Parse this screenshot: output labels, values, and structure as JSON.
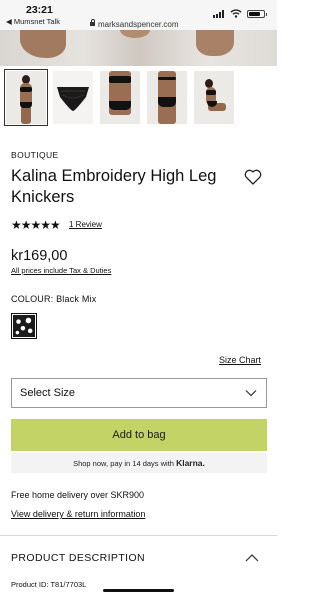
{
  "status_bar": {
    "time": "23:21",
    "back_app": "◀ Mumsnet Talk",
    "url": "marksandspencer.com",
    "battery_level": 0.78
  },
  "gallery": {
    "thumbnail_count": 5,
    "active_index": 0
  },
  "product": {
    "brand": "BOUTIQUE",
    "title": "Kalina Embroidery High Leg Knickers",
    "rating_stars": "★★★★★",
    "rating_value": 5,
    "reviews_link": "1 Review",
    "price": "kr169,00",
    "tax_note": "All prices include Tax & Duties",
    "colour_label": "COLOUR: Black Mix"
  },
  "size": {
    "size_chart_link": "Size Chart",
    "select_label": "Select Size"
  },
  "actions": {
    "add_to_bag": "Add to bag",
    "klarna_text": "Shop now, pay in 14 days with",
    "klarna_brand": "Klarna."
  },
  "delivery": {
    "free_delivery": "Free home delivery over SKR900",
    "info_link": "View delivery & return information"
  },
  "description": {
    "header": "PRODUCT DESCRIPTION",
    "product_id": "Product ID: T81/7703L"
  },
  "colors": {
    "add_to_bag_bg": "#c3d366",
    "klarna_bg": "#f3f3f3",
    "text": "#111111"
  }
}
